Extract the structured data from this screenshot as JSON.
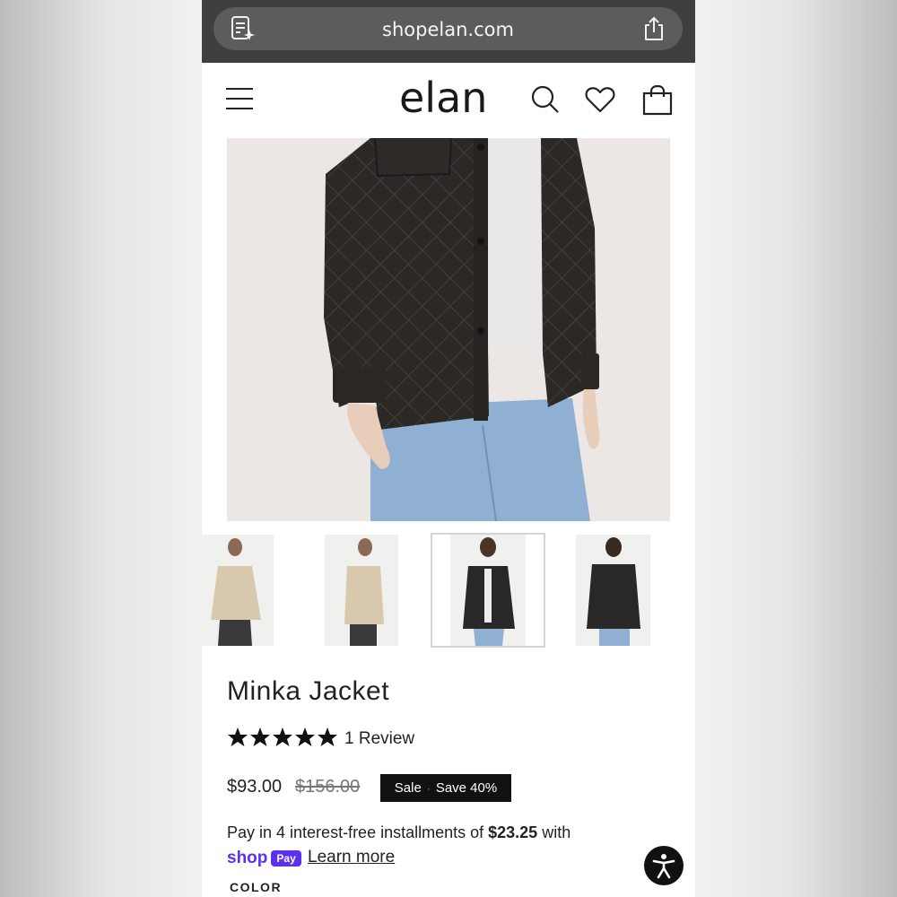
{
  "browser": {
    "url": "shopelan.com",
    "reader_icon": "reader-mode-icon",
    "share_icon": "share-icon"
  },
  "header": {
    "menu_icon": "hamburger-menu-icon",
    "logo": "elan",
    "search_icon": "search-icon",
    "wishlist_icon": "heart-icon",
    "cart_icon": "shopping-bag-icon"
  },
  "gallery": {
    "main_image": "black quilted faux leather jacket worn over white tee and light blue jeans",
    "thumbnails": [
      {
        "color": "#d9c9b0",
        "description": "beige quilted jacket, front"
      },
      {
        "color": "#d9c9b0",
        "description": "beige quilted jacket, side"
      },
      {
        "color": "#2a2826",
        "description": "black quilted jacket, front",
        "selected": true
      },
      {
        "color": "#2a2826",
        "description": "black quilted jacket, back"
      }
    ]
  },
  "product": {
    "title": "Minka Jacket",
    "rating": 5,
    "rating_max": 5,
    "review_text": "1 Review",
    "price": "$93.00",
    "compare_price": "$156.00",
    "badge_sale": "Sale",
    "badge_save": "Save 40%",
    "installments_prefix": "Pay in 4 interest-free installments of ",
    "installment_amount": "$23.25",
    "installments_suffix": " with",
    "shop_pay_word": "shop",
    "shop_pay_box": "Pay",
    "learn_more": "Learn more",
    "color_label": "COLOR"
  },
  "accessibility_icon": "accessibility-icon",
  "colors": {
    "browser_bar": "#3d3f40",
    "url_pill": "#5a5c5e",
    "shop_pay": "#5a31f4",
    "badge_bg": "#111111"
  }
}
